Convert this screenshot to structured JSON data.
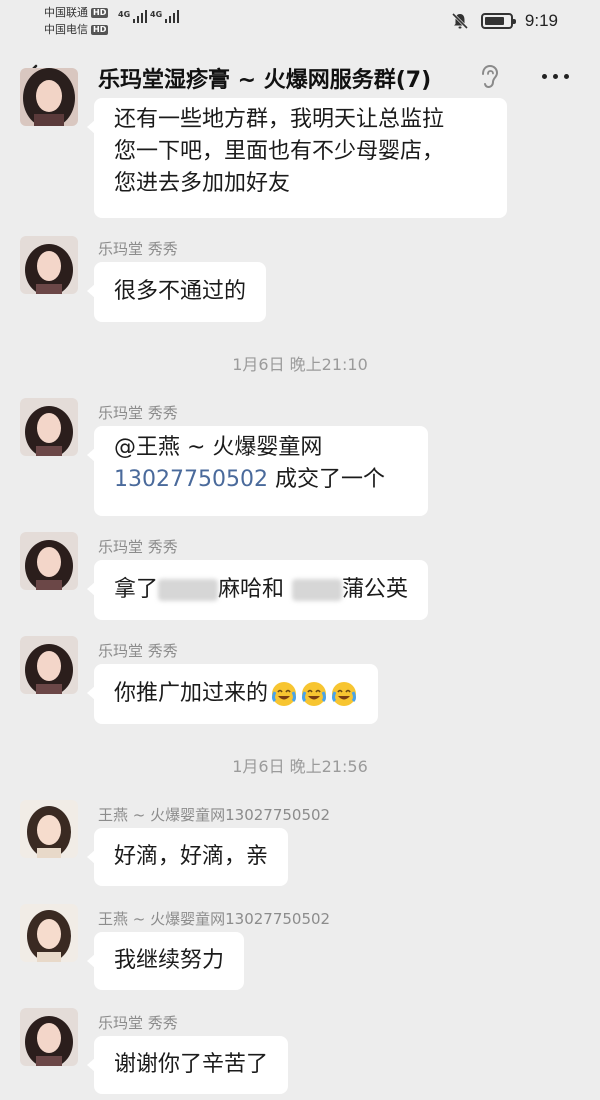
{
  "status_bar": {
    "carrier1": "中国联通",
    "carrier2": "中国电信",
    "hd_badge": "HD",
    "network": "4G",
    "time": "9:19",
    "battery_level": 0.8
  },
  "header": {
    "title": "乐玛堂湿疹膏 ~ 火爆网服务群(7)",
    "icons": [
      "back-icon",
      "ear-icon",
      "more-icon"
    ]
  },
  "messages": {
    "m1": {
      "lines": [
        "还有一些地方群，我明天让总监拉",
        "您一下吧，里面也有不少母婴店，",
        "您进去多加加好友"
      ]
    },
    "m2": {
      "sender": "乐玛堂 秀秀",
      "text": "很多不通过的"
    },
    "ts1": "1月6日 晚上21:10",
    "m3": {
      "sender": "乐玛堂 秀秀",
      "line1": "@王燕 ~ 火爆婴童网",
      "phone": "13027750502",
      "line2_rest": " 成交了一个"
    },
    "m4": {
      "sender": "乐玛堂 秀秀",
      "part1": "拿了",
      "part2": "麻哈和",
      "part3": "蒲公英"
    },
    "m5": {
      "sender": "乐玛堂 秀秀",
      "text": "你推广加过来的",
      "emoji": "crying-laughing-emoji"
    },
    "ts2": "1月6日 晚上21:56",
    "m6": {
      "sender": "王燕 ~ 火爆婴童网13027750502",
      "text": "好滴，好滴，亲"
    },
    "m7": {
      "sender": "王燕 ~ 火爆婴童网13027750502",
      "text": "我继续努力"
    },
    "m8": {
      "sender": "乐玛堂 秀秀",
      "text": "谢谢你了辛苦了"
    }
  }
}
